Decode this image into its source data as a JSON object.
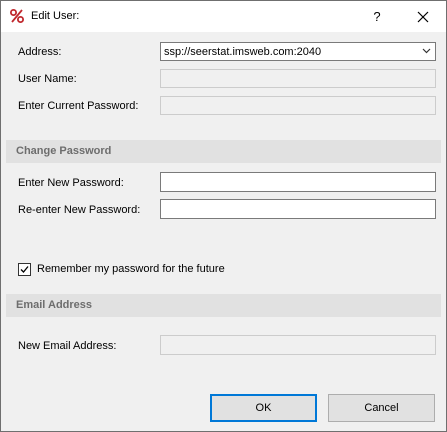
{
  "window": {
    "title": "Edit User:",
    "help_glyph": "?"
  },
  "server": {
    "address_label": "Address:",
    "address_value": "ssp://seerstat.imsweb.com:2040",
    "username_label": "User Name:",
    "username_value": "",
    "current_password_label": "Enter Current Password:",
    "current_password_value": ""
  },
  "change_password": {
    "section_title": "Change Password",
    "new_label": "Enter New Password:",
    "new_value": "",
    "reenter_label": "Re-enter New Password:",
    "reenter_value": ""
  },
  "remember": {
    "label": "Remember my password for the future",
    "checked": true
  },
  "email": {
    "section_title": "Email Address",
    "new_label": "New Email Address:",
    "new_value": ""
  },
  "buttons": {
    "ok": "OK",
    "cancel": "Cancel"
  },
  "colors": {
    "accent": "#0078d7",
    "section_bg": "#e1e1e1",
    "section_text": "#6d6d6d",
    "icon_red": "#c0272d"
  },
  "icons": {
    "app": "percent-icon",
    "close": "close-icon",
    "dropdown": "chevron-down-icon",
    "check": "checkmark-icon"
  }
}
